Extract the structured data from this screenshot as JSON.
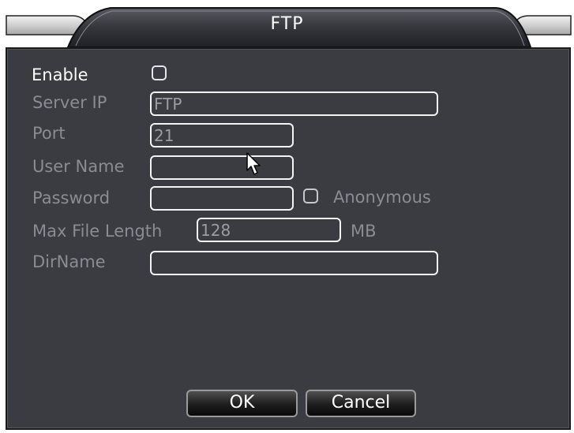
{
  "window": {
    "title": "FTP"
  },
  "form": {
    "enable_label": "Enable",
    "server_ip_label": "Server IP",
    "server_ip_value": "FTP",
    "port_label": "Port",
    "port_value": "21",
    "user_name_label": "User Name",
    "user_name_value": "",
    "password_label": "Password",
    "password_value": "",
    "anonymous_label": "Anonymous",
    "max_file_length_label": "Max File Length",
    "max_file_length_value": "128",
    "max_file_length_unit": "MB",
    "dirname_label": "DirName",
    "dirname_value": ""
  },
  "buttons": {
    "ok": "OK",
    "cancel": "Cancel"
  },
  "icons": {
    "cursor": "mouse-pointer-icon"
  }
}
